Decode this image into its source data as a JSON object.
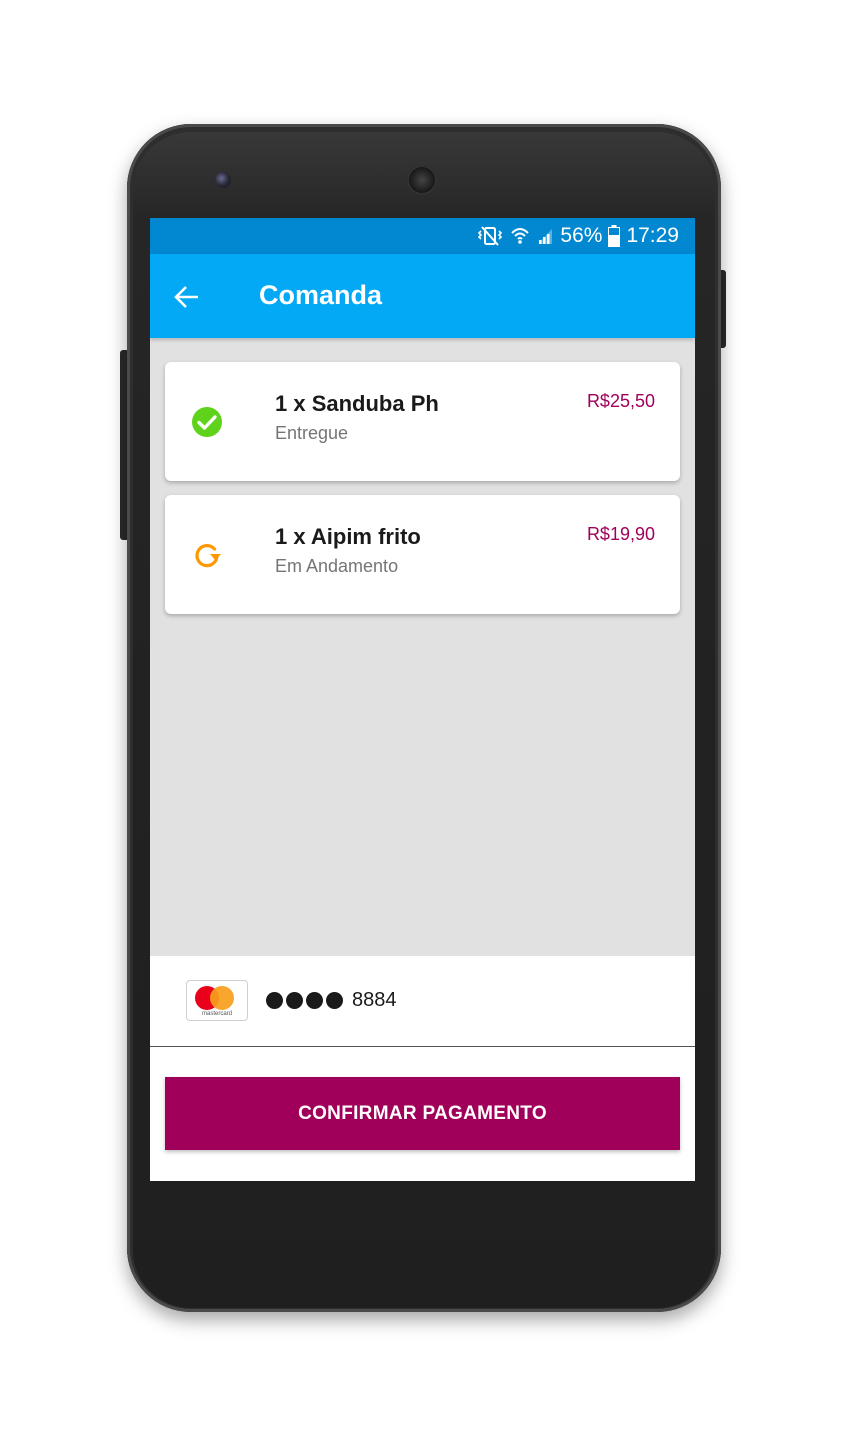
{
  "status_bar": {
    "battery": "56%",
    "time": "17:29",
    "icons": [
      "vibrate-silent-icon",
      "wifi-icon",
      "signal-icon",
      "battery-icon"
    ]
  },
  "app_bar": {
    "back_icon": "arrow-left-icon",
    "title": "Comanda",
    "background": "#03a9f4"
  },
  "orders": [
    {
      "name": "1 x Sanduba Ph",
      "status": "Entregue",
      "price": "R$25,50",
      "icon": "check-circle-icon",
      "icon_color": "#5fd21b"
    },
    {
      "name": "1 x Aipim frito",
      "status": "Em Andamento",
      "price": "R$19,90",
      "icon": "refresh-icon",
      "icon_color": "#ff9800"
    }
  ],
  "payment": {
    "brand_icon": "mastercard-icon",
    "brand_text": "mastercard",
    "masked_dots": 4,
    "last_digits": "8884"
  },
  "actions": {
    "confirm_label": "CONFIRMAR PAGAMENTO",
    "confirm_color": "#a0005a"
  },
  "colors": {
    "status_bar": "#0288d1",
    "price": "#a0005a"
  }
}
